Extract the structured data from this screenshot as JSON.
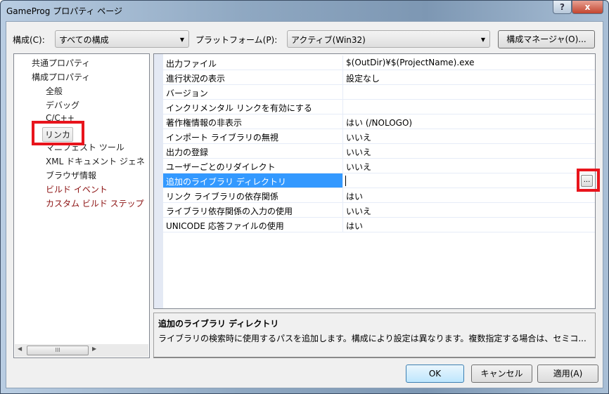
{
  "window": {
    "title": "GameProg プロパティ ページ",
    "help": "?",
    "close": "x"
  },
  "toolbar": {
    "config_label": "構成(C):",
    "config_value": "すべての構成",
    "platform_label": "プラットフォーム(P):",
    "platform_value": "アクティブ(Win32)",
    "manager_button": "構成マネージャ(O)..."
  },
  "tree": {
    "items": [
      {
        "label": "共通プロパティ",
        "level": 0
      },
      {
        "label": "構成プロパティ",
        "level": 0
      },
      {
        "label": "全般",
        "level": 1
      },
      {
        "label": "デバッグ",
        "level": 1
      },
      {
        "label": "C/C++",
        "level": 1
      },
      {
        "label": "リンカ",
        "level": 1,
        "selected": true
      },
      {
        "label": "マニフェスト ツール",
        "level": 1
      },
      {
        "label": "XML ドキュメント ジェネ",
        "level": 1
      },
      {
        "label": "ブラウザ情報",
        "level": 1
      },
      {
        "label": "ビルド イベント",
        "level": 1
      },
      {
        "label": "カスタム ビルド ステップ",
        "level": 1
      }
    ],
    "scroll_grip": "III"
  },
  "grid": {
    "rows": [
      {
        "name": "出力ファイル",
        "value": "$(OutDir)¥$(ProjectName).exe"
      },
      {
        "name": "進行状況の表示",
        "value": "設定なし"
      },
      {
        "name": "バージョン",
        "value": ""
      },
      {
        "name": "インクリメンタル リンクを有効にする",
        "value": ""
      },
      {
        "name": "著作権情報の非表示",
        "value": "はい (/NOLOGO)"
      },
      {
        "name": "インポート ライブラリの無視",
        "value": "いいえ"
      },
      {
        "name": "出力の登録",
        "value": "いいえ"
      },
      {
        "name": "ユーザーごとのリダイレクト",
        "value": "いいえ"
      },
      {
        "name": "追加のライブラリ ディレクトリ",
        "value": "",
        "selected": true
      },
      {
        "name": "リンク ライブラリの依存関係",
        "value": "はい"
      },
      {
        "name": "ライブラリ依存関係の入力の使用",
        "value": "いいえ"
      },
      {
        "name": "UNICODE 応答ファイルの使用",
        "value": "はい"
      }
    ],
    "browse_button": "..."
  },
  "description": {
    "title": "追加のライブラリ ディレクトリ",
    "text": "ライブラリの検索時に使用するパスを追加します。構成により設定は異なります。複数指定する場合は、セミコ..."
  },
  "buttons": {
    "ok": "OK",
    "cancel": "キャンセル",
    "apply": "適用(A)"
  },
  "colors": {
    "selection": "#3399ff",
    "highlight": "#e8141c"
  }
}
